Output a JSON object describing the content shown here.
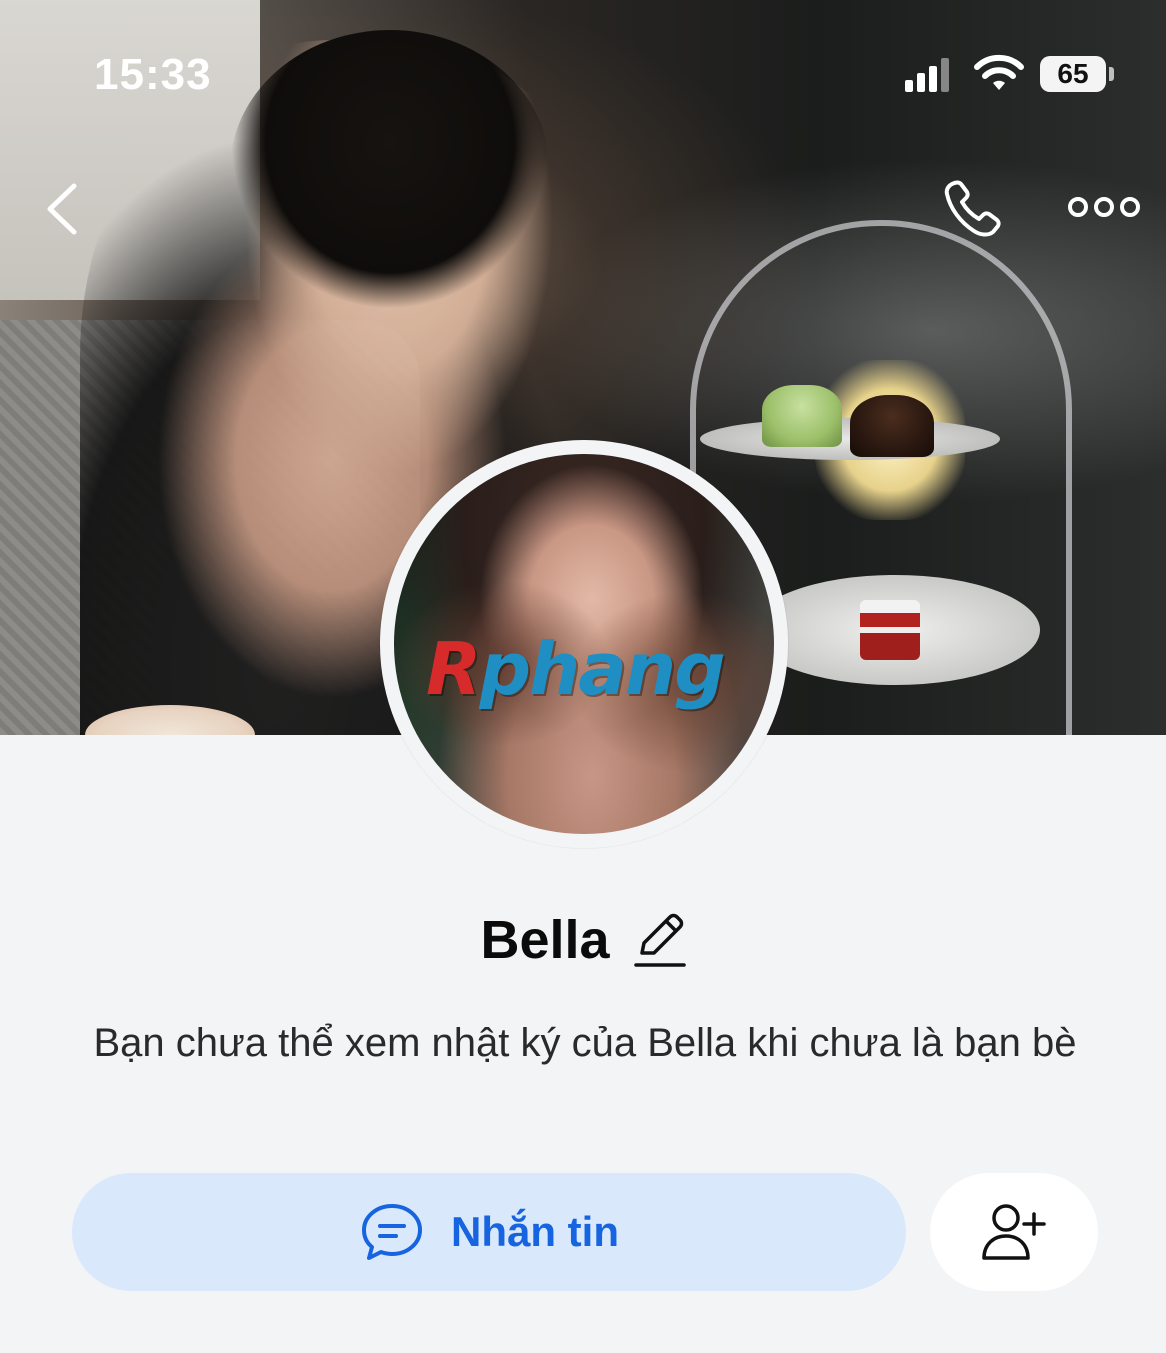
{
  "status_bar": {
    "time": "15:33",
    "battery_level": "65",
    "icons": [
      "signal-icon",
      "wifi-icon",
      "battery-icon"
    ]
  },
  "nav": {
    "icons": [
      "back-chevron-icon",
      "phone-icon",
      "more-dots-icon"
    ]
  },
  "avatar": {
    "watermark_first": "R",
    "watermark_rest": "phang"
  },
  "profile": {
    "name": "Bella",
    "edit_icon": "pencil-icon",
    "notice": "Bạn chưa thể xem nhật ký của Bella khi chưa là bạn bè"
  },
  "actions": {
    "message_label": "Nhắn tin",
    "message_icon": "chat-bubble-icon",
    "add_friend_icon": "add-user-icon"
  },
  "colors": {
    "accent": "#1664e0",
    "message_button_bg": "#d9e9fb",
    "page_bg": "#f3f4f6"
  }
}
